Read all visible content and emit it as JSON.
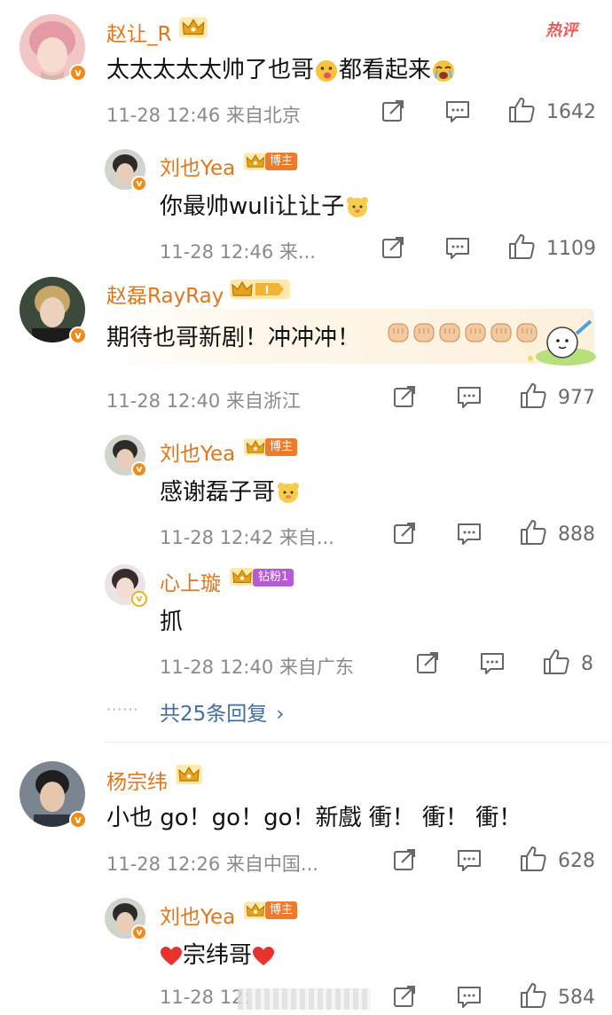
{
  "hot_label": "热评",
  "comments": [
    {
      "user": "赵让_R",
      "text_a": "太太太太太帅了也哥",
      "text_b": "都看起来",
      "time": "11-28 12:46 来自北京",
      "likes": "1642"
    },
    {
      "user": "刘也Yea",
      "badge": "博主",
      "text_a": "你最帅wuli让让子",
      "time": "11-28 12:46 来...",
      "likes": "1109"
    },
    {
      "user": "赵磊RayRay",
      "text_a": "期待也哥新剧！冲冲冲！",
      "time": "11-28 12:40 来自浙江",
      "likes": "977"
    },
    {
      "user": "刘也Yea",
      "badge": "博主",
      "text_a": "感谢磊子哥",
      "time": "11-28 12:42 来自...",
      "likes": "888"
    },
    {
      "user": "心上璇",
      "badge": "钻粉1",
      "text_a": "抓",
      "time": "11-28 12:40 来自广东",
      "likes": "8"
    },
    {
      "user": "杨宗纬",
      "text_a": "小也 go！go！go！新戲 衝！ 衝！ 衝！",
      "time": "11-28 12:26 来自中国...",
      "likes": "628"
    },
    {
      "user": "刘也Yea",
      "badge": "博主",
      "text_a": "宗纬哥",
      "time": "11-28 12:",
      "likes": "584"
    }
  ],
  "more_replies": "共25条回复",
  "more_replies_dots": "······",
  "icons": {
    "share": "share-icon",
    "comment": "comment-icon",
    "like": "thumbs-up-icon",
    "verified": "verified-v-icon",
    "crown": "crown-icon"
  },
  "colors": {
    "username": "#e2761d",
    "meta": "#8a8a8a",
    "link": "#3f6ea5",
    "hot": "#ef5a5a",
    "blogger_badge": "#f07a2c",
    "fan_badge": "#b65bd8"
  }
}
